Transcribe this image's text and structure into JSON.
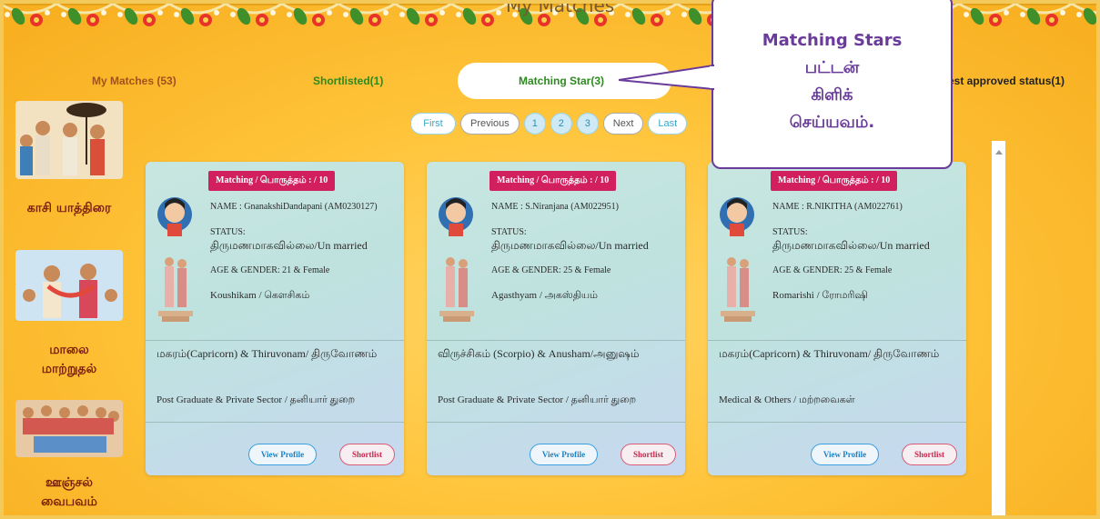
{
  "page": {
    "title": "My Matches"
  },
  "tabs": [
    {
      "label": "My Matches (53)",
      "color": "#a0521e"
    },
    {
      "label": "Shortlisted(1)",
      "color": "#2d8a1f"
    },
    {
      "label": "Matching Star(3)",
      "color": "#2d8a1f"
    },
    {
      "label": "est approved status(1)",
      "color": "#222222"
    }
  ],
  "pagination": {
    "first": "First",
    "previous": "Previous",
    "pages": [
      "1",
      "2",
      "3"
    ],
    "next": "Next",
    "last": "Last"
  },
  "sidebar": {
    "items": [
      {
        "label": "காசி யாத்திரை"
      },
      {
        "label_line1": "மாலை",
        "label_line2": "மாற்றுதல்"
      },
      {
        "label_line1": "ஊஞ்சல்",
        "label_line2": "வைபவம்"
      }
    ]
  },
  "callout": {
    "line1": "Matching Stars",
    "line2": "பட்டன்",
    "line3": "கிளிக்",
    "line4": "செய்யவம்."
  },
  "cards": [
    {
      "badge": "Matching / பொருத்தம் : / 10",
      "name": "NAME : GnanakshiDandapani (AM0230127)",
      "status_label": "STATUS:",
      "status": "திருமணமாகவில்லை/Un married",
      "age_gender": "AGE & GENDER: 21 & Female",
      "gotra": "Koushikam / கௌசிகம்",
      "rasi": "மகரம்(Capricorn) & Thiruvonam/ திருவோணம்",
      "education": "Post Graduate & Private Sector / தனியார் துறை",
      "view": "View Profile",
      "shortlist": "Shortlist"
    },
    {
      "badge": "Matching / பொருத்தம் : / 10",
      "name": "NAME : S.Niranjana (AM022951)",
      "status_label": "STATUS:",
      "status": "திருமணமாகவில்லை/Un married",
      "age_gender": "AGE & GENDER: 25 & Female",
      "gotra": "Agasthyam / அகஸ்தியம்",
      "rasi": "விருச்சிகம் (Scorpio) & Anusham/அனுஷம்",
      "education": "Post Graduate & Private Sector / தனியார் துறை",
      "view": "View Profile",
      "shortlist": "Shortlist"
    },
    {
      "badge": "Matching / பொருத்தம் : / 10",
      "name": "NAME : R.NIKITHA (AM022761)",
      "status_label": "STATUS:",
      "status": "திருமணமாகவில்லை/Un married",
      "age_gender": "AGE & GENDER: 25 & Female",
      "gotra": "Romarishi / ரோமரிஷி",
      "rasi": "மகரம்(Capricorn) & Thiruvonam/ திருவோணம்",
      "education": "Medical & Others / மற்றவைகள்",
      "view": "View Profile",
      "shortlist": "Shortlist"
    }
  ]
}
